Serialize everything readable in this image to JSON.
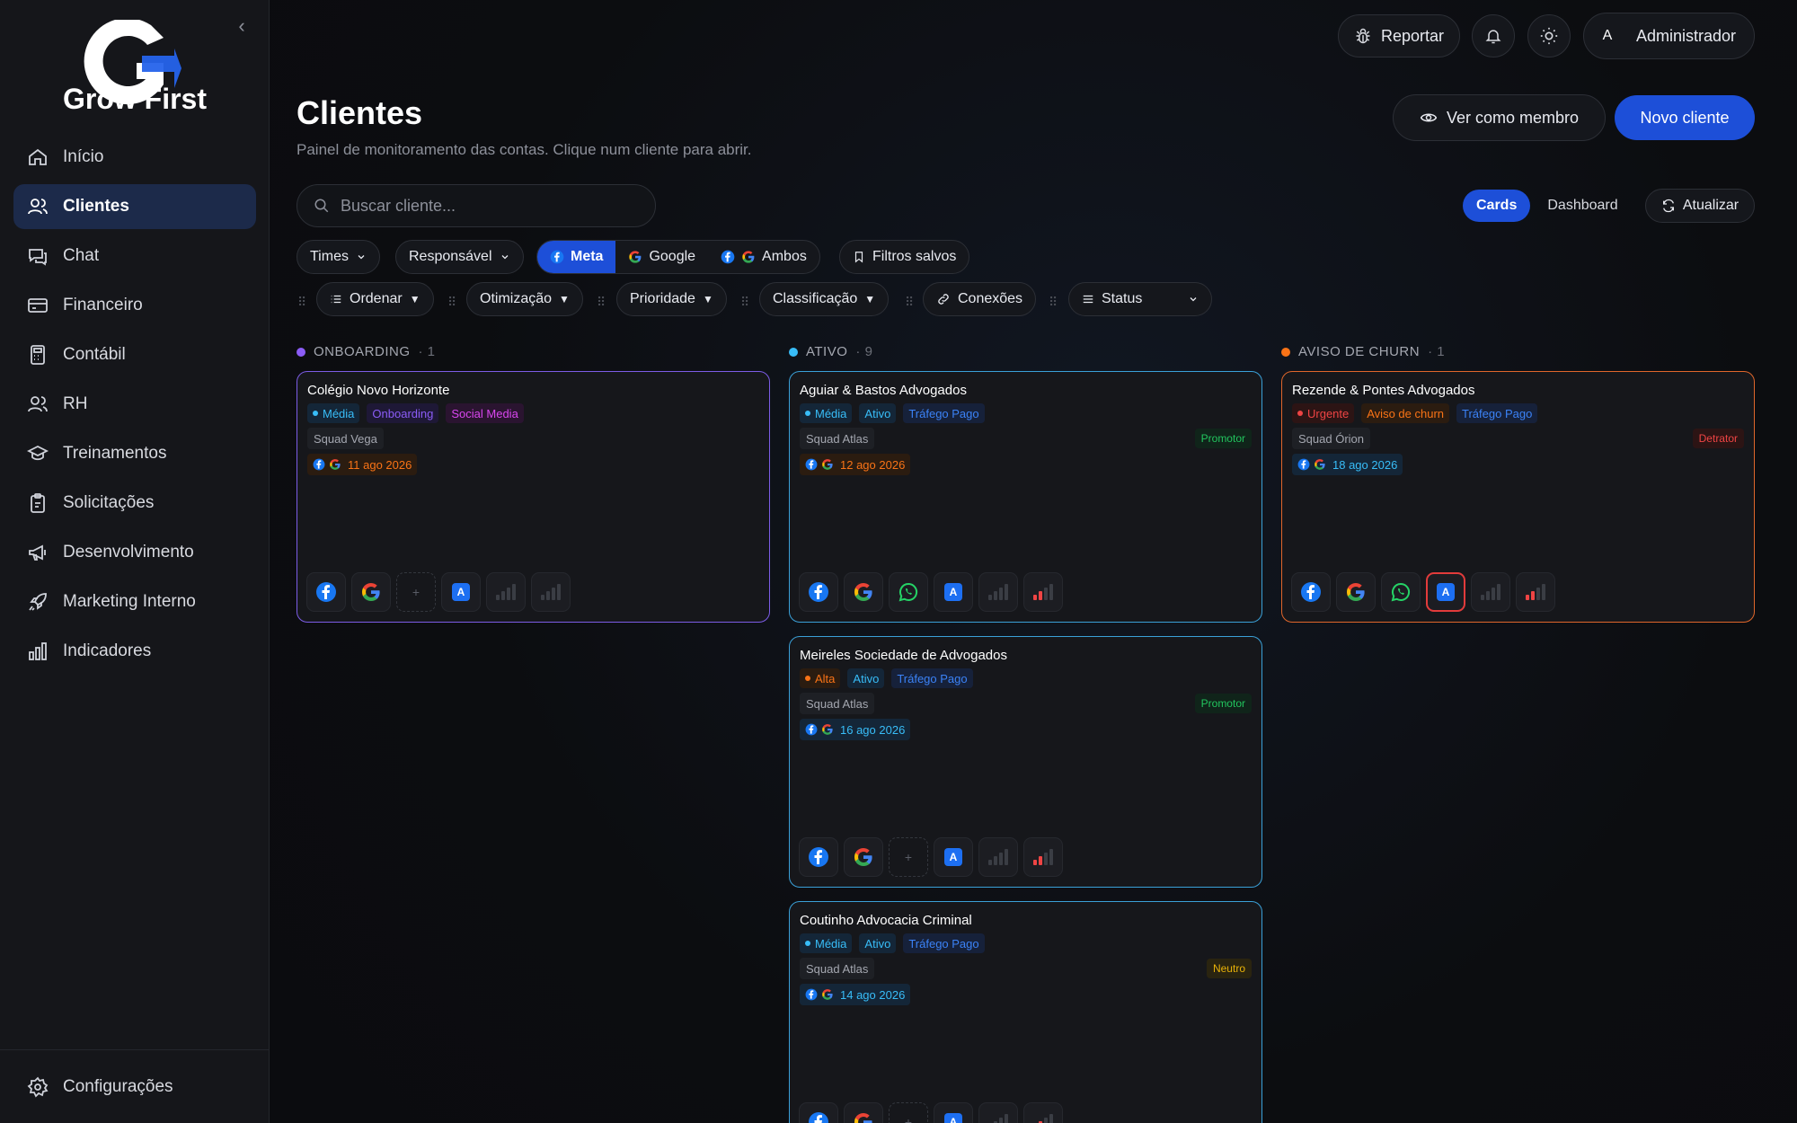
{
  "brand": {
    "name": "Grow First"
  },
  "sidebar": {
    "items": [
      {
        "label": "Início",
        "icon": "home-icon"
      },
      {
        "label": "Clientes",
        "icon": "users-icon",
        "active": true
      },
      {
        "label": "Chat",
        "icon": "chat-icon"
      },
      {
        "label": "Financeiro",
        "icon": "card-icon"
      },
      {
        "label": "Contábil",
        "icon": "calculator-icon"
      },
      {
        "label": "RH",
        "icon": "people-icon"
      },
      {
        "label": "Treinamentos",
        "icon": "graduation-cap-icon"
      },
      {
        "label": "Solicitações",
        "icon": "clipboard-icon"
      },
      {
        "label": "Desenvolvimento",
        "icon": "megaphone-icon"
      },
      {
        "label": "Marketing Interno",
        "icon": "rocket-icon"
      },
      {
        "label": "Indicadores",
        "icon": "bar-chart-icon"
      }
    ],
    "settings_label": "Configurações"
  },
  "topbar": {
    "report_label": "Reportar",
    "user_initial": "A",
    "user_name": "Administrador"
  },
  "page": {
    "title": "Clientes",
    "subtitle": "Painel de monitoramento das contas. Clique num cliente para abrir.",
    "view_member_label": "Ver como membro",
    "new_client_label": "Novo cliente",
    "search_placeholder": "Buscar cliente..."
  },
  "views": {
    "cards": "Cards",
    "dashboard": "Dashboard",
    "refresh": "Atualizar",
    "active": "Cards"
  },
  "filters": {
    "times": "Times",
    "responsavel": "Responsável",
    "platform_options": [
      "Meta",
      "Google",
      "Ambos"
    ],
    "platform_selected": "Meta",
    "saved": "Filtros salvos",
    "sort": [
      "Ordenar",
      "Otimização",
      "Prioridade",
      "Classificação",
      "Conexões",
      "Status"
    ]
  },
  "columns": [
    {
      "label": "ONBOARDING",
      "count": "· 1",
      "color": "#8b5cf6"
    },
    {
      "label": "ATIVO",
      "count": "· 9",
      "color": "#38bdf8"
    },
    {
      "label": "AVISO DE CHURN",
      "count": "· 1",
      "color": "#f97316"
    }
  ],
  "cards": [
    {
      "name": "Colégio Novo Horizonte",
      "priority": "Média",
      "status": "Onboarding",
      "service": "Social Media",
      "squad": "Squad Vega",
      "nps": "",
      "date": "11 ago 2026",
      "border": "#7c5ce6"
    },
    {
      "name": "Aguiar & Bastos Advogados",
      "priority": "Média",
      "status": "Ativo",
      "service": "Tráfego Pago",
      "squad": "Squad Atlas",
      "nps": "Promotor",
      "date": "12 ago 2026",
      "border": "#3aa0d8"
    },
    {
      "name": "Rezende & Pontes Advogados",
      "priority": "Urgente",
      "status": "Aviso de churn",
      "service": "Tráfego Pago",
      "squad": "Squad Órion",
      "nps": "Detrator",
      "date": "18 ago 2026",
      "border": "#e0662b"
    },
    {
      "name": "Meireles Sociedade de Advogados",
      "priority": "Alta",
      "status": "Ativo",
      "service": "Tráfego Pago",
      "squad": "Squad Atlas",
      "nps": "Promotor",
      "date": "16 ago 2026",
      "border": "#3aa0d8"
    },
    {
      "name": "Coutinho Advocacia Criminal",
      "priority": "Média",
      "status": "Ativo",
      "service": "Tráfego Pago",
      "squad": "Squad Atlas",
      "nps": "Neutro",
      "date": "14 ago 2026",
      "border": "#3aa0d8"
    }
  ],
  "card_add_label": "+",
  "ads_badge_label": "A"
}
